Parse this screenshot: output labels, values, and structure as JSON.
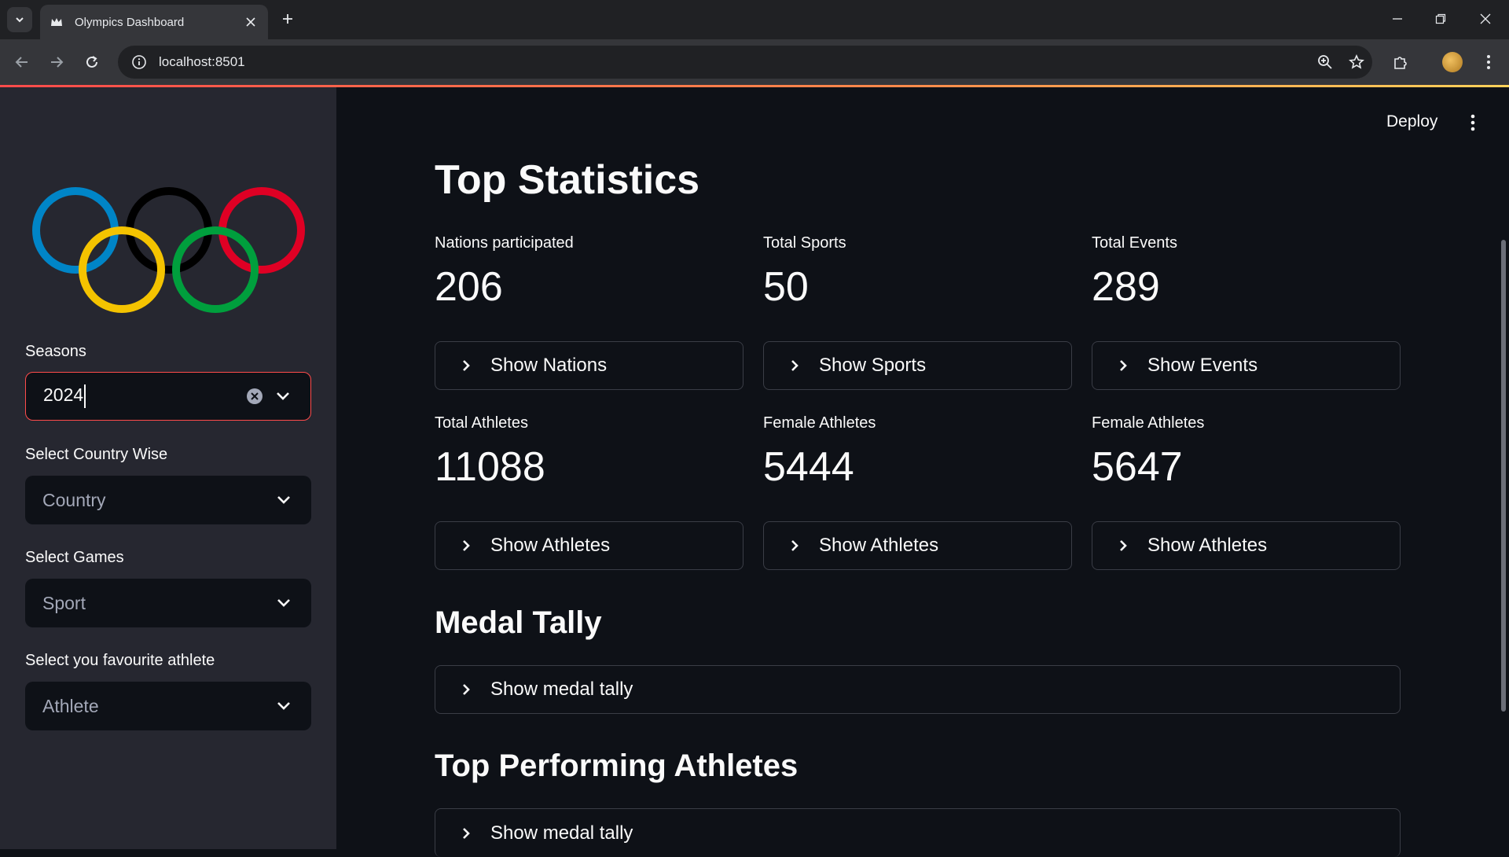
{
  "browser": {
    "tab_title": "Olympics Dashboard",
    "url": "localhost:8501"
  },
  "sidebar": {
    "seasons_label": "Seasons",
    "seasons_value": "2024",
    "country_label": "Select Country Wise",
    "country_placeholder": "Country",
    "games_label": "Select Games",
    "games_placeholder": "Sport",
    "athlete_label": "Select you favourite athlete",
    "athlete_placeholder": "Athlete"
  },
  "header": {
    "deploy_label": "Deploy"
  },
  "main": {
    "title": "Top Statistics",
    "metrics": [
      {
        "label": "Nations participated",
        "value": "206",
        "expander": "Show Nations"
      },
      {
        "label": "Total Sports",
        "value": "50",
        "expander": "Show Sports"
      },
      {
        "label": "Total Events",
        "value": "289",
        "expander": "Show Events"
      },
      {
        "label": "Total Athletes",
        "value": "11088",
        "expander": "Show Athletes"
      },
      {
        "label": "Female Athletes",
        "value": "5444",
        "expander": "Show Athletes"
      },
      {
        "label": "Female Athletes",
        "value": "5647",
        "expander": "Show Athletes"
      }
    ],
    "medal_tally": {
      "heading": "Medal Tally",
      "expander": "Show medal tally"
    },
    "top_athletes": {
      "heading": "Top Performing Athletes",
      "expander": "Show medal tally"
    }
  },
  "colors": {
    "accent": "#ff4b4b",
    "background": "#0e1117",
    "sidebar": "#262730",
    "ring_blue": "#0085c7",
    "ring_black": "#000000",
    "ring_red": "#df0024",
    "ring_yellow": "#f4c300",
    "ring_green": "#009f3d"
  }
}
